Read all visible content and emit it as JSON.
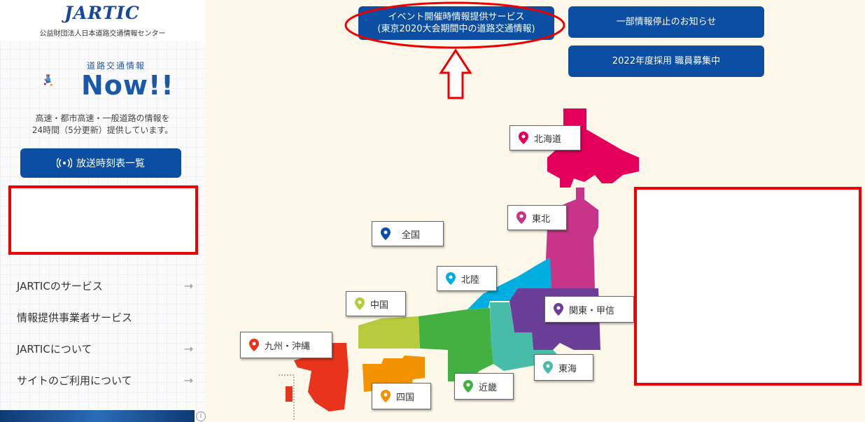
{
  "header": {
    "logo": "JARTIC",
    "org": "公益財団法人日本道路交通情報センター"
  },
  "brand": {
    "subtitle": "道路交通情報",
    "title": "Now!!"
  },
  "sidebar": {
    "description": [
      "高速・都市高速・一般道路の情報を",
      "24時間（5分更新）提供しています。"
    ],
    "broadcast_button": "放送時刻表一覧",
    "nav": [
      {
        "label": "JARTICのサービス",
        "arrow": "→"
      },
      {
        "label": "情報提供事業者サービス",
        "arrow": ""
      },
      {
        "label": "JARTICについて",
        "arrow": "→"
      },
      {
        "label": "サイトのご利用について",
        "arrow": "→"
      }
    ]
  },
  "top_buttons": {
    "event_line1": "イベント開催時情報提供サービス",
    "event_line2": "(東京2020大会期間中の道路交通情報)",
    "notice": "一部情報停止のお知らせ",
    "recruit": "2022年度採用 職員募集中"
  },
  "regions": [
    {
      "id": "hokkaido",
      "label": "北海道",
      "color": "#e4005a"
    },
    {
      "id": "tohoku",
      "label": "東北",
      "color": "#c6358a"
    },
    {
      "id": "zenkoku",
      "label": "全国",
      "color": "#0b4ea2"
    },
    {
      "id": "hokuriku",
      "label": "北陸",
      "color": "#00aee0"
    },
    {
      "id": "chugoku",
      "label": "中国",
      "color": "#b6cc3d"
    },
    {
      "id": "kanto",
      "label": "関東・甲信",
      "color": "#6b3f97"
    },
    {
      "id": "kyushu",
      "label": "九州・沖縄",
      "color": "#e8341c"
    },
    {
      "id": "tokai",
      "label": "東海",
      "color": "#47bca9"
    },
    {
      "id": "kinki",
      "label": "近畿",
      "color": "#43b142"
    },
    {
      "id": "shikoku",
      "label": "四国",
      "color": "#f39200"
    }
  ]
}
